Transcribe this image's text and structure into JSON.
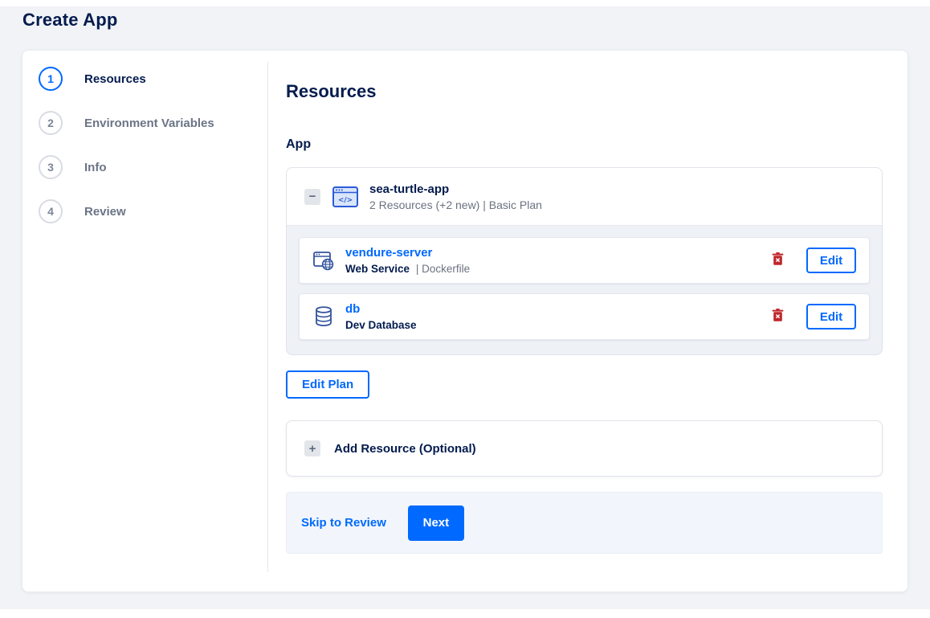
{
  "page": {
    "title": "Create App"
  },
  "stepper": {
    "steps": [
      {
        "number": "1",
        "label": "Resources",
        "active": true
      },
      {
        "number": "2",
        "label": "Environment Variables",
        "active": false
      },
      {
        "number": "3",
        "label": "Info",
        "active": false
      },
      {
        "number": "4",
        "label": "Review",
        "active": false
      }
    ]
  },
  "main": {
    "heading": "Resources",
    "section_label": "App",
    "app_card": {
      "collapse_glyph": "−",
      "icon": "app-window-code-icon",
      "name": "sea-turtle-app",
      "summary": "2 Resources (+2 new) | Basic Plan",
      "resources": [
        {
          "icon": "web-service-icon",
          "name": "vendure-server",
          "subtitle_bold": "Web Service",
          "subtitle_rest": "| Dockerfile",
          "delete_icon": "trash-icon",
          "edit_label": "Edit"
        },
        {
          "icon": "database-icon",
          "name": "db",
          "subtitle_bold": "Dev Database",
          "subtitle_rest": "",
          "delete_icon": "trash-icon",
          "edit_label": "Edit"
        }
      ]
    },
    "edit_plan_label": "Edit Plan",
    "add_resource": {
      "plus_glyph": "+",
      "label": "Add Resource (Optional)"
    },
    "footer": {
      "skip_label": "Skip to Review",
      "next_label": "Next"
    }
  },
  "colors": {
    "accent": "#0069ff",
    "navy": "#031b4e",
    "danger": "#c0262b",
    "page_bg": "#f1f3f6"
  }
}
